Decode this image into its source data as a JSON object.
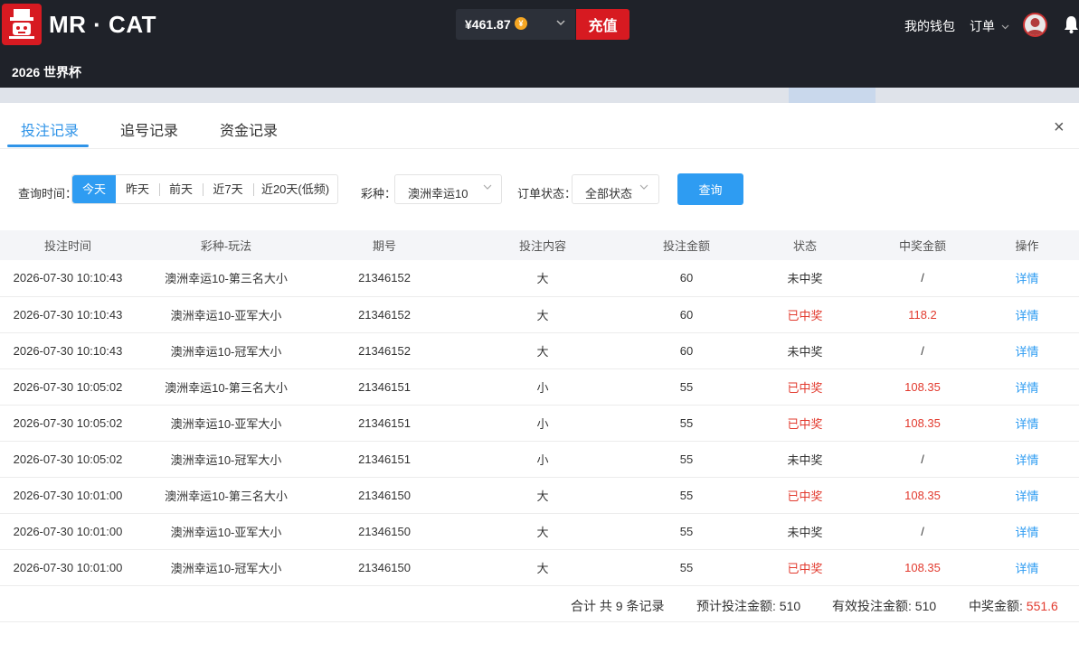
{
  "header": {
    "brand": "MR · CAT",
    "balance": "¥461.87",
    "coin_glyph": "¥",
    "recharge_label": "充值",
    "wallet_label": "我的钱包",
    "orders_label": "订单",
    "subtitle": "2026 世界杯"
  },
  "modal": {
    "tabs": [
      {
        "label": "投注记录",
        "active": true
      },
      {
        "label": "追号记录",
        "active": false
      },
      {
        "label": "资金记录",
        "active": false
      }
    ],
    "close_glyph": "×",
    "filters": {
      "time_label": "查询时间：",
      "time_options": [
        "今天",
        "昨天",
        "前天",
        "近7天",
        "近20天(低频)"
      ],
      "lottery_label": "彩种：",
      "lottery_value": "澳洲幸运10",
      "status_label": "订单状态：",
      "status_value": "全部状态",
      "query_label": "查询"
    },
    "table": {
      "columns": [
        "投注时间",
        "彩种-玩法",
        "期号",
        "投注内容",
        "投注金额",
        "状态",
        "中奖金额",
        "操作"
      ],
      "rows": [
        [
          "2026-07-30 10:10:43",
          "澳洲幸运10-第三名大小",
          "21346152",
          "大",
          "60",
          "未中奖",
          "/",
          "详情"
        ],
        [
          "2026-07-30 10:10:43",
          "澳洲幸运10-亚军大小",
          "21346152",
          "大",
          "60",
          "已中奖",
          "118.2",
          "详情"
        ],
        [
          "2026-07-30 10:10:43",
          "澳洲幸运10-冠军大小",
          "21346152",
          "大",
          "60",
          "未中奖",
          "/",
          "详情"
        ],
        [
          "2026-07-30 10:05:02",
          "澳洲幸运10-第三名大小",
          "21346151",
          "小",
          "55",
          "已中奖",
          "108.35",
          "详情"
        ],
        [
          "2026-07-30 10:05:02",
          "澳洲幸运10-亚军大小",
          "21346151",
          "小",
          "55",
          "已中奖",
          "108.35",
          "详情"
        ],
        [
          "2026-07-30 10:05:02",
          "澳洲幸运10-冠军大小",
          "21346151",
          "小",
          "55",
          "未中奖",
          "/",
          "详情"
        ],
        [
          "2026-07-30 10:01:00",
          "澳洲幸运10-第三名大小",
          "21346150",
          "大",
          "55",
          "已中奖",
          "108.35",
          "详情"
        ],
        [
          "2026-07-30 10:01:00",
          "澳洲幸运10-亚军大小",
          "21346150",
          "大",
          "55",
          "未中奖",
          "/",
          "详情"
        ],
        [
          "2026-07-30 10:01:00",
          "澳洲幸运10-冠军大小",
          "21346150",
          "大",
          "55",
          "已中奖",
          "108.35",
          "详情"
        ]
      ],
      "won_status": "已中奖"
    },
    "summary": {
      "total": "合计 共 9 条记录",
      "expected_label": "预计投注金额: 510",
      "effective_label": "有效投注金额: 510",
      "win_label": "中奖金额: ",
      "win_value": "551.6"
    }
  },
  "colors": {
    "accent": "#2e9cf2",
    "brand_red": "#d71a21",
    "win_red": "#e23a2e",
    "topbar": "#1f2229"
  }
}
